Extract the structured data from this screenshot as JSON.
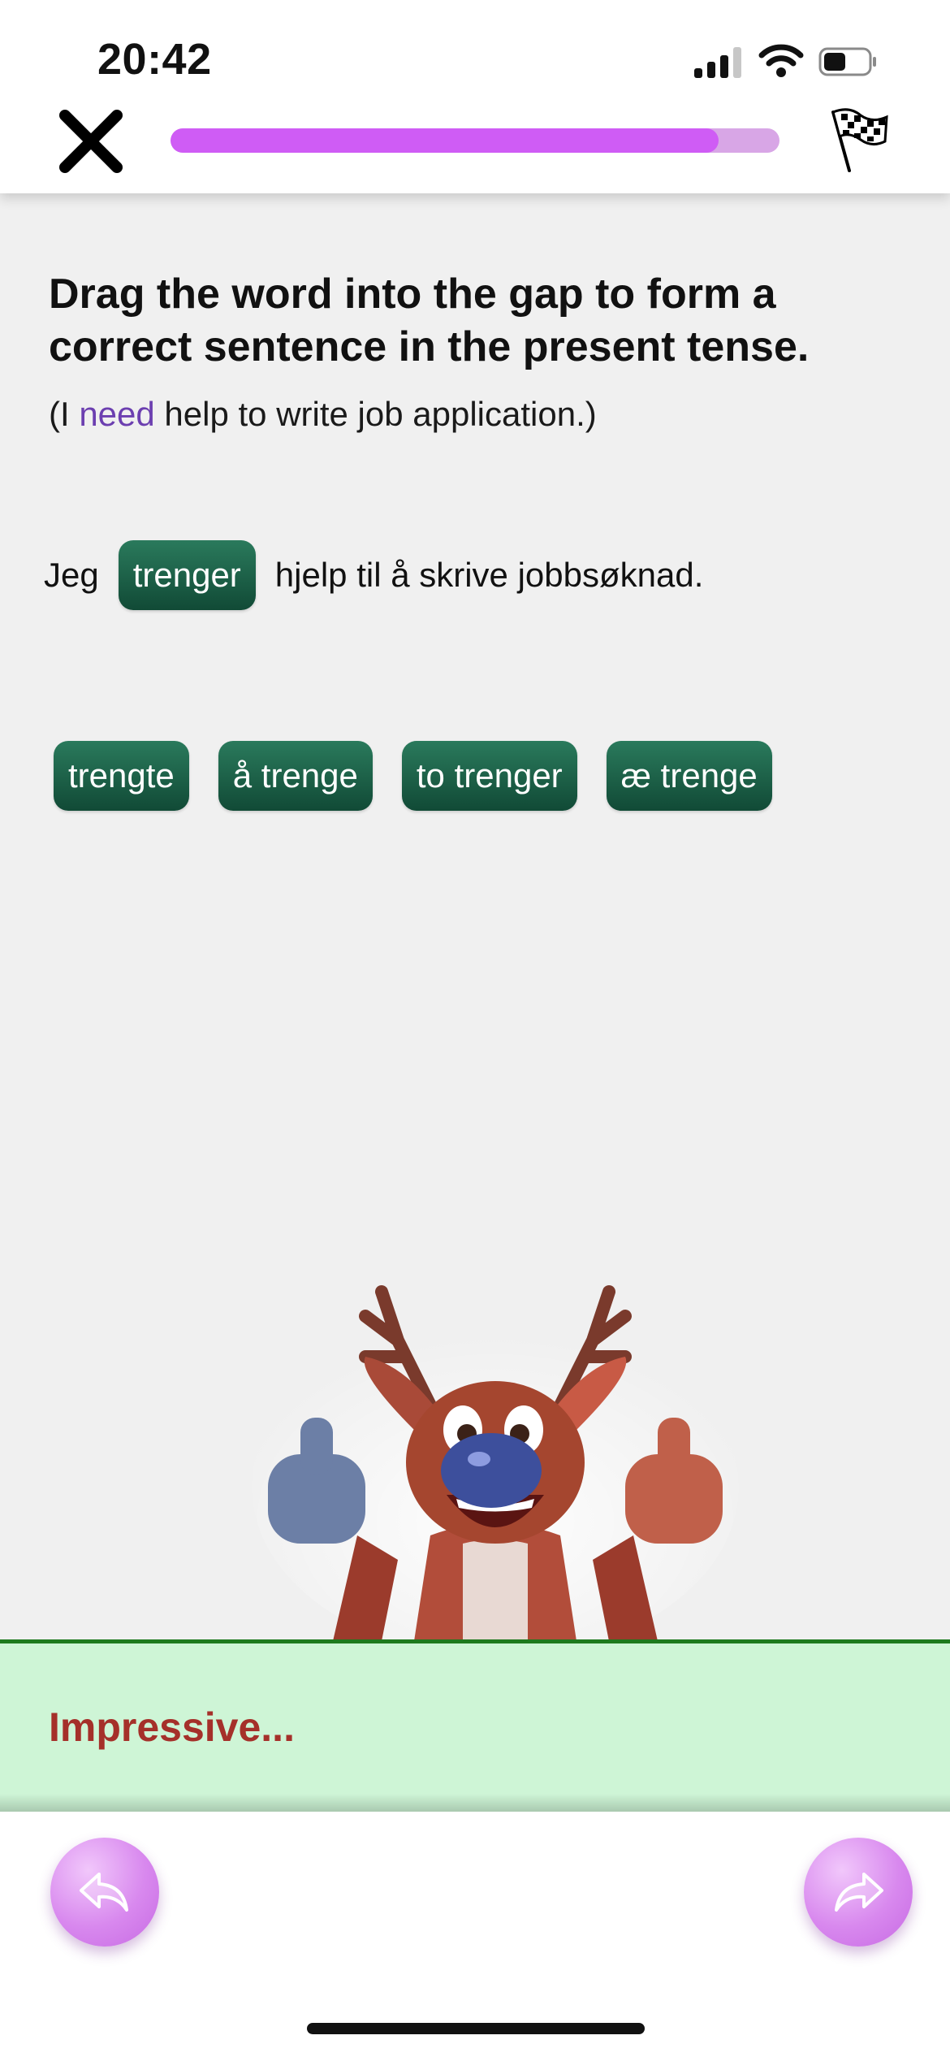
{
  "status_bar": {
    "time": "20:42"
  },
  "header": {
    "close_icon": "close-icon",
    "finish_icon": "checkered-flag-icon",
    "progress_fraction": 0.9
  },
  "exercise": {
    "instruction": "Drag the word into the gap to form a correct sentence in the present tense.",
    "translation": {
      "prefix": "(I ",
      "highlight": "need",
      "suffix": " help to write job application.)"
    },
    "sentence": {
      "before": "Jeg",
      "filled_word": "trenger",
      "after": "hjelp til å skrive jobbsøknad."
    },
    "options": [
      "trengte",
      "å trenge",
      "to trenger",
      "æ trenge"
    ]
  },
  "feedback": {
    "message": "Impressive..."
  },
  "navigation": {
    "prev_icon": "undo-arrow-icon",
    "next_icon": "redo-arrow-icon"
  },
  "colors": {
    "accent": "#cf5cf5",
    "chip": "#1a5e45",
    "feedback_bg": "#cef5d6",
    "feedback_text": "#a5302a",
    "highlight": "#6c3fb0"
  }
}
